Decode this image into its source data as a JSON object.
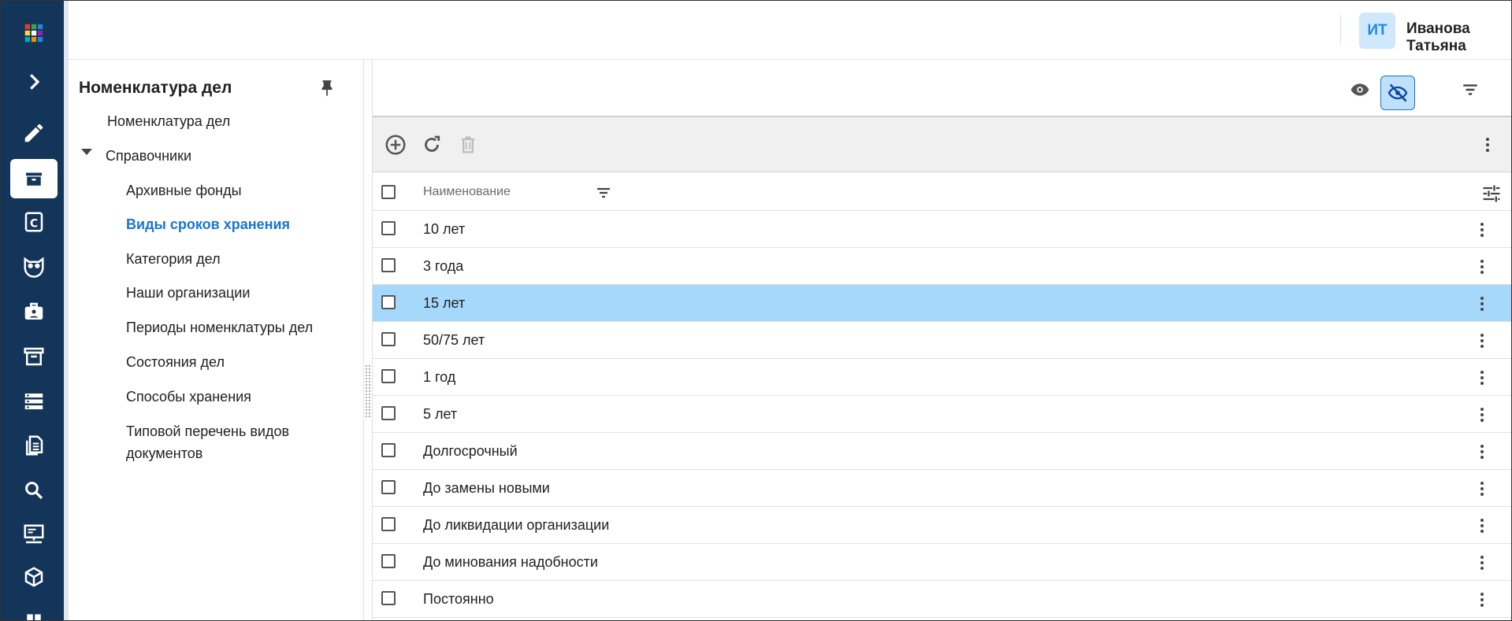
{
  "header": {
    "avatar_initials": "ИТ",
    "user_name": "Иванова Татьяна"
  },
  "rail": {
    "items": [
      {
        "icon": "apps-grid-icon"
      },
      {
        "icon": "chevron-right-icon"
      },
      {
        "icon": "pencil-icon"
      },
      {
        "icon": "archive-box-icon",
        "active": true
      },
      {
        "icon": "c-letter-icon"
      },
      {
        "icon": "owl-icon"
      },
      {
        "icon": "badge-briefcase-icon"
      },
      {
        "icon": "archive-icon"
      },
      {
        "icon": "server-icon"
      },
      {
        "icon": "documents-icon"
      },
      {
        "icon": "search-icon"
      },
      {
        "icon": "monitor-network-icon"
      },
      {
        "icon": "cube-icon"
      },
      {
        "icon": "partial-icon"
      }
    ]
  },
  "nav": {
    "title": "Номенклатура дел",
    "root_item": "Номенклатура дел",
    "group_label": "Справочники",
    "items": [
      "Архивные фонды",
      "Виды сроков хранения",
      "Категория дел",
      "Наши организации",
      "Периоды номенклатуры дел",
      "Состояния дел",
      "Способы хранения",
      "Типовой перечень видов",
      "документов"
    ],
    "active_index": 1
  },
  "grid": {
    "column_name": "Наименование",
    "rows": [
      "10 лет",
      "3 года",
      "15 лет",
      "50/75 лет",
      "1 год",
      "5 лет",
      "Долгосрочный",
      "До замены новыми",
      "До ликвидации организации",
      "До минования надобности",
      "Постоянно"
    ],
    "selected_index": 2
  },
  "colors": {
    "rail_bg": "#14355a",
    "accent": "#1976d2",
    "selected_row": "#a5d8fb",
    "avatar_bg": "#cfe8fb"
  }
}
